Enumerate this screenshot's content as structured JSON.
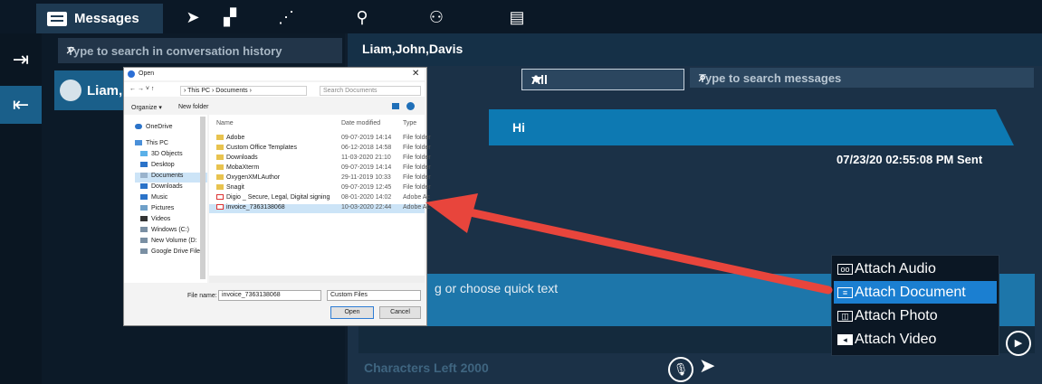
{
  "topnav": {
    "messages_label": "Messages",
    "icons": [
      "chat-icon",
      "send-nav-icon",
      "location-nav-icon",
      "route-icon",
      "place-icon",
      "group-icon",
      "media-icon"
    ]
  },
  "rail": {
    "icons": [
      "login-icon",
      "logout-icon"
    ]
  },
  "conversations": {
    "search_placeholder": "Type to search in conversation history",
    "items": [
      {
        "name": "Liam,..."
      }
    ]
  },
  "chat": {
    "title": "Liam,John,Davis",
    "filter_value": "All",
    "search_placeholder": "Type to search messages",
    "messages": [
      {
        "text": "Hi",
        "meta": "07/23/20 02:55:08 PM Sent"
      }
    ],
    "composer_placeholder": "g or choose quick text",
    "chars_left": "Characters Left 2000"
  },
  "attach_menu": {
    "items": [
      {
        "label": "Attach Audio",
        "icon": "audio-icon"
      },
      {
        "label": "Attach Document",
        "icon": "document-icon",
        "selected": true
      },
      {
        "label": "Attach Photo",
        "icon": "photo-icon"
      },
      {
        "label": "Attach Video",
        "icon": "video-icon"
      }
    ],
    "highlight_color": "#1b7fd1"
  },
  "annotation": {
    "arrow_color": "#e8453c"
  },
  "open_dialog": {
    "title": "Open",
    "breadcrumb": "› This PC › Documents ›",
    "search_placeholder": "Search Documents",
    "organize": "Organize ▾",
    "new_folder": "New folder",
    "col_name": "Name",
    "col_date": "Date modified",
    "col_type": "Type",
    "nav": [
      "OneDrive",
      "This PC",
      "3D Objects",
      "Desktop",
      "Documents",
      "Downloads",
      "Music",
      "Pictures",
      "Videos",
      "Windows (C:)",
      "New Volume (D:",
      "Google Drive File"
    ],
    "files": [
      {
        "name": "Adobe",
        "date": "09-07-2019 14:14",
        "type": "File folder"
      },
      {
        "name": "Custom Office Templates",
        "date": "06-12-2018 14:58",
        "type": "File folder"
      },
      {
        "name": "Downloads",
        "date": "11-03-2020 21:10",
        "type": "File folder"
      },
      {
        "name": "MobaXterm",
        "date": "09-07-2019 14:14",
        "type": "File folder"
      },
      {
        "name": "OxygenXMLAuthor",
        "date": "29-11-2019 10:33",
        "type": "File folder"
      },
      {
        "name": "Snagit",
        "date": "09-07-2019 12:45",
        "type": "File folder"
      },
      {
        "name": "Digio _ Secure, Legal, Digital signing",
        "date": "08-01-2020 14:02",
        "type": "Adobe Ac"
      },
      {
        "name": "invoice_7363138068",
        "date": "10-03-2020 22:44",
        "type": "Adobe Ac"
      }
    ],
    "file_name_label": "File name:",
    "file_name_value": "invoice_7363138068",
    "filter": "Custom Files",
    "open": "Open",
    "cancel": "Cancel"
  }
}
